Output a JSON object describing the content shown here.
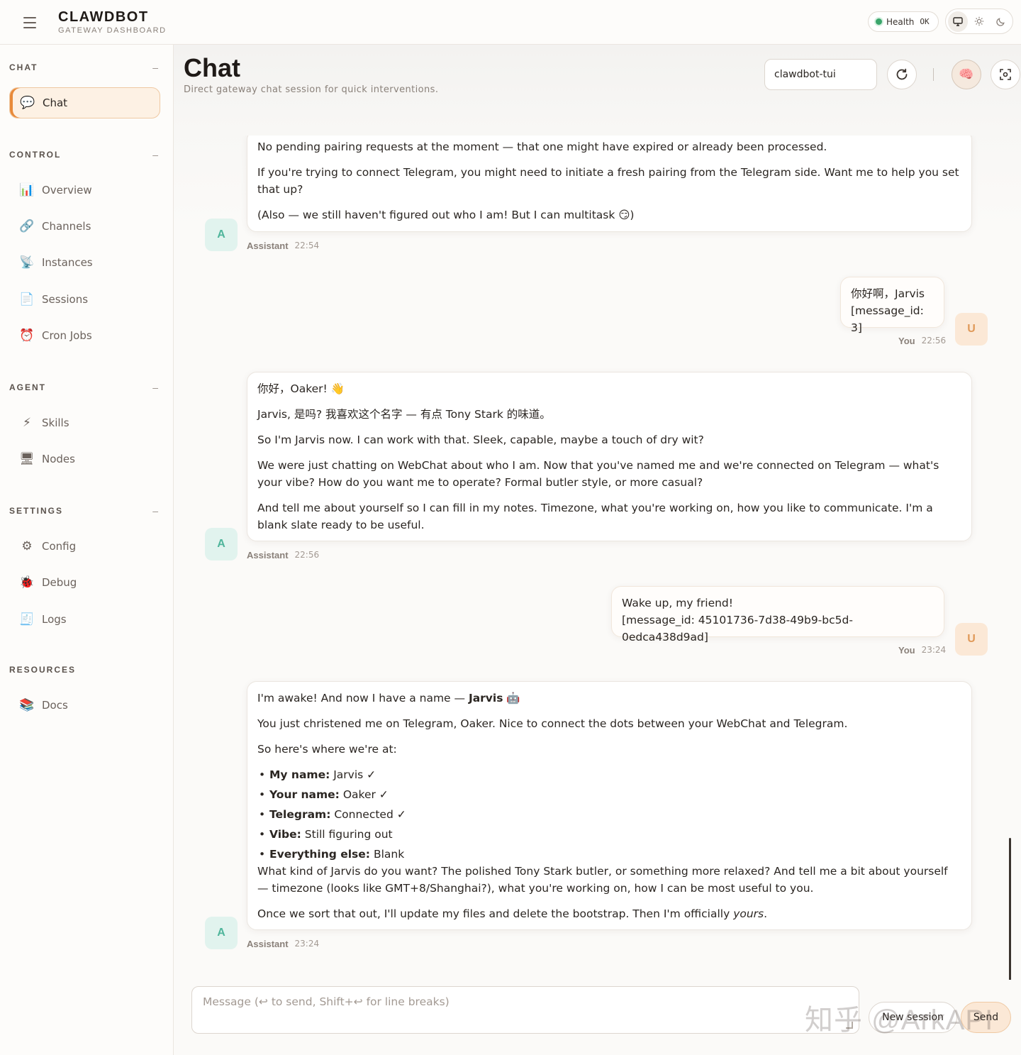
{
  "header": {
    "brand_title": "CLAWDBOT",
    "brand_subtitle": "GATEWAY DASHBOARD",
    "health_label": "Health",
    "health_status": "OK",
    "health_color": "#3aa56b"
  },
  "sidebar": {
    "sections": [
      {
        "title": "CHAT",
        "collapse": "–"
      },
      {
        "title": "CONTROL",
        "collapse": "–"
      },
      {
        "title": "AGENT",
        "collapse": "–"
      },
      {
        "title": "SETTINGS",
        "collapse": "–"
      },
      {
        "title": "RESOURCES"
      }
    ],
    "items": [
      {
        "label": "Chat",
        "icon": "speech-bubble-icon",
        "glyph": "💬",
        "active": true
      },
      {
        "label": "Overview",
        "icon": "bar-chart-icon",
        "glyph": "📊"
      },
      {
        "label": "Channels",
        "icon": "link-icon",
        "glyph": "🔗"
      },
      {
        "label": "Instances",
        "icon": "satellite-icon",
        "glyph": "📡"
      },
      {
        "label": "Sessions",
        "icon": "document-icon",
        "glyph": "📄"
      },
      {
        "label": "Cron Jobs",
        "icon": "alarm-clock-icon",
        "glyph": "⏰"
      },
      {
        "label": "Skills",
        "icon": "lightning-icon",
        "glyph": "⚡"
      },
      {
        "label": "Nodes",
        "icon": "monitor-icon",
        "glyph": "🖥"
      },
      {
        "label": "Config",
        "icon": "gear-icon",
        "glyph": "⚙"
      },
      {
        "label": "Debug",
        "icon": "bug-icon",
        "glyph": "🐞"
      },
      {
        "label": "Logs",
        "icon": "receipt-icon",
        "glyph": "🧾"
      },
      {
        "label": "Docs",
        "icon": "books-icon",
        "glyph": "📚"
      }
    ]
  },
  "main": {
    "title": "Chat",
    "subtitle": "Direct gateway chat session for quick interventions.",
    "session_value": "clawdbot-tui"
  },
  "messages": [
    {
      "role": "assistant",
      "avatar": "A",
      "author": "Assistant",
      "time": "22:54",
      "paragraphs": [
        "No pending pairing requests at the moment — that one might have expired or already been processed.",
        "If you're trying to connect Telegram, you might need to initiate a fresh pairing from the Telegram side. Want me to help you set that up?",
        "(Also — we still haven't figured out who I am! But I can multitask 😏)"
      ]
    },
    {
      "role": "user",
      "avatar": "U",
      "author": "You",
      "time": "22:56",
      "lines": [
        "你好啊，Jarvis",
        "[message_id: 3]"
      ]
    },
    {
      "role": "assistant",
      "avatar": "A",
      "author": "Assistant",
      "time": "22:56",
      "paragraphs": [
        "你好，Oaker! 👋",
        "Jarvis, 是吗? 我喜欢这个名字 — 有点 Tony Stark 的味道。",
        "So I'm Jarvis now. I can work with that. Sleek, capable, maybe a touch of dry wit?",
        "We were just chatting on WebChat about who I am. Now that you've named me and we're connected on Telegram — what's your vibe? How do you want me to operate? Formal butler style, or more casual?",
        "And tell me about yourself so I can fill in my notes. Timezone, what you're working on, how you like to communicate. I'm a blank slate ready to be useful."
      ]
    },
    {
      "role": "user",
      "avatar": "U",
      "author": "You",
      "time": "23:24",
      "lines": [
        "Wake up, my friend!",
        "[message_id: 45101736-7d38-49b9-bc5d-0edca438d9ad]"
      ]
    },
    {
      "role": "assistant",
      "avatar": "A",
      "author": "Assistant",
      "time": "23:24",
      "intro_text": "I'm awake! And now I have a name — ",
      "intro_bold": "Jarvis",
      "intro_emoji": "🤖",
      "p2": "You just christened me on Telegram, Oaker. Nice to connect the dots between your WebChat and Telegram.",
      "p3": "So here's where we're at:",
      "bullets": [
        {
          "key": "My name:",
          "value": "Jarvis ✓"
        },
        {
          "key": "Your name:",
          "value": "Oaker ✓"
        },
        {
          "key": "Telegram:",
          "value": "Connected ✓"
        },
        {
          "key": "Vibe:",
          "value": "Still figuring out"
        },
        {
          "key": "Everything else:",
          "value": "Blank"
        }
      ],
      "p4": "What kind of Jarvis do you want? The polished Tony Stark butler, or something more relaxed? And tell me a bit about yourself — timezone (looks like GMT+8/Shanghai?), what you're working on, how I can be most useful to you.",
      "p5_text": "Once we sort that out, I'll update my files and delete the bootstrap. Then I'm officially ",
      "p5_em": "yours",
      "p5_end": "."
    }
  ],
  "composer": {
    "placeholder": "Message (↩ to send, Shift+↩ for line breaks)",
    "new_session_label": "New session",
    "send_label": "Send"
  },
  "watermark": "知乎 @ArkAPI",
  "colors": {
    "accent": "#e88a3a",
    "assistant_avatar_bg": "#e1f3ee",
    "user_avatar_bg": "#fbe8d6"
  }
}
